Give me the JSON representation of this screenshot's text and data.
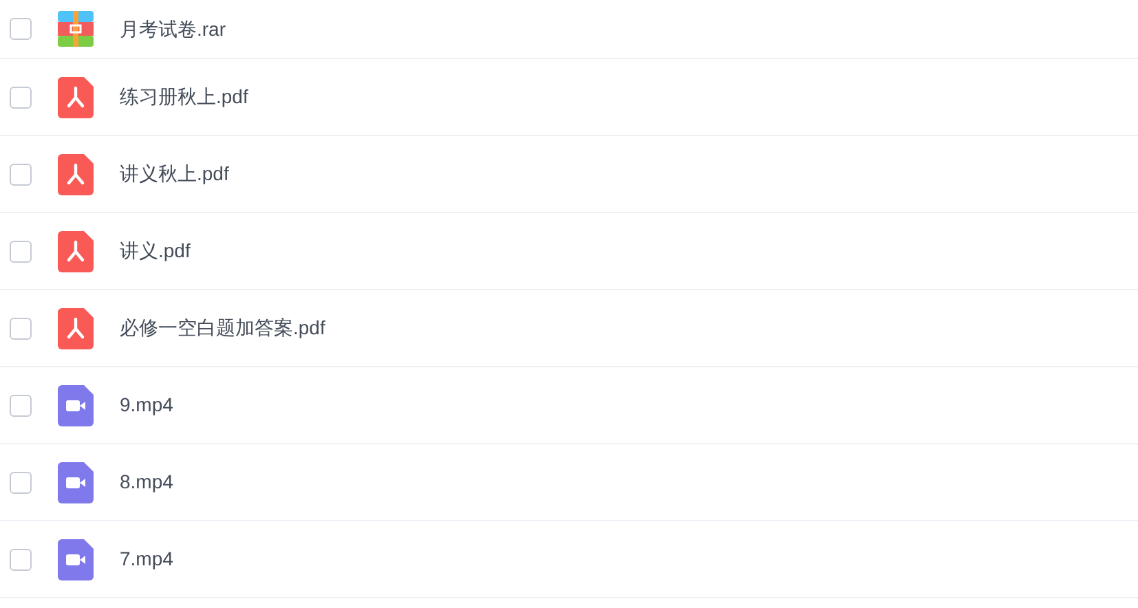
{
  "files": [
    {
      "name": "月考试卷.rar",
      "kind": "archive",
      "checked": false
    },
    {
      "name": "练习册秋上.pdf",
      "kind": "pdf",
      "checked": false
    },
    {
      "name": "讲义秋上.pdf",
      "kind": "pdf",
      "checked": false
    },
    {
      "name": "讲义.pdf",
      "kind": "pdf",
      "checked": false
    },
    {
      "name": "必修一空白题加答案.pdf",
      "kind": "pdf",
      "checked": false
    },
    {
      "name": "9.mp4",
      "kind": "video",
      "checked": false
    },
    {
      "name": "8.mp4",
      "kind": "video",
      "checked": false
    },
    {
      "name": "7.mp4",
      "kind": "video",
      "checked": false
    }
  ]
}
